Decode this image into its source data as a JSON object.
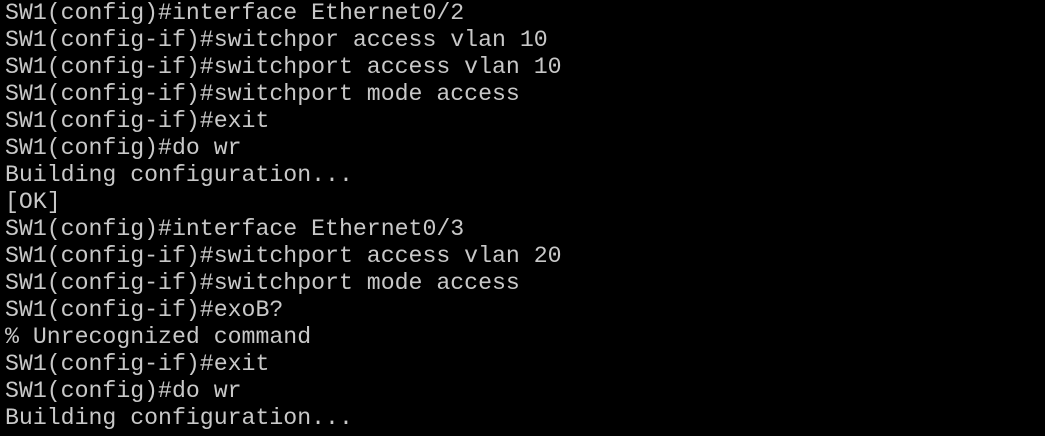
{
  "terminal": {
    "lines": [
      "SW1(config)#interface Ethernet0/2",
      "SW1(config-if)#switchpor access vlan 10",
      "SW1(config-if)#switchport access vlan 10",
      "SW1(config-if)#switchport mode access",
      "SW1(config-if)#exit",
      "SW1(config)#do wr",
      "Building configuration...",
      "[OK]",
      "SW1(config)#interface Ethernet0/3",
      "SW1(config-if)#switchport access vlan 20",
      "SW1(config-if)#switchport mode access",
      "SW1(config-if)#exoB?",
      "% Unrecognized command",
      "SW1(config-if)#exit",
      "SW1(config)#do wr",
      "Building configuration..."
    ],
    "colors": {
      "background": "#000000",
      "text": "#c8c8c8"
    }
  }
}
